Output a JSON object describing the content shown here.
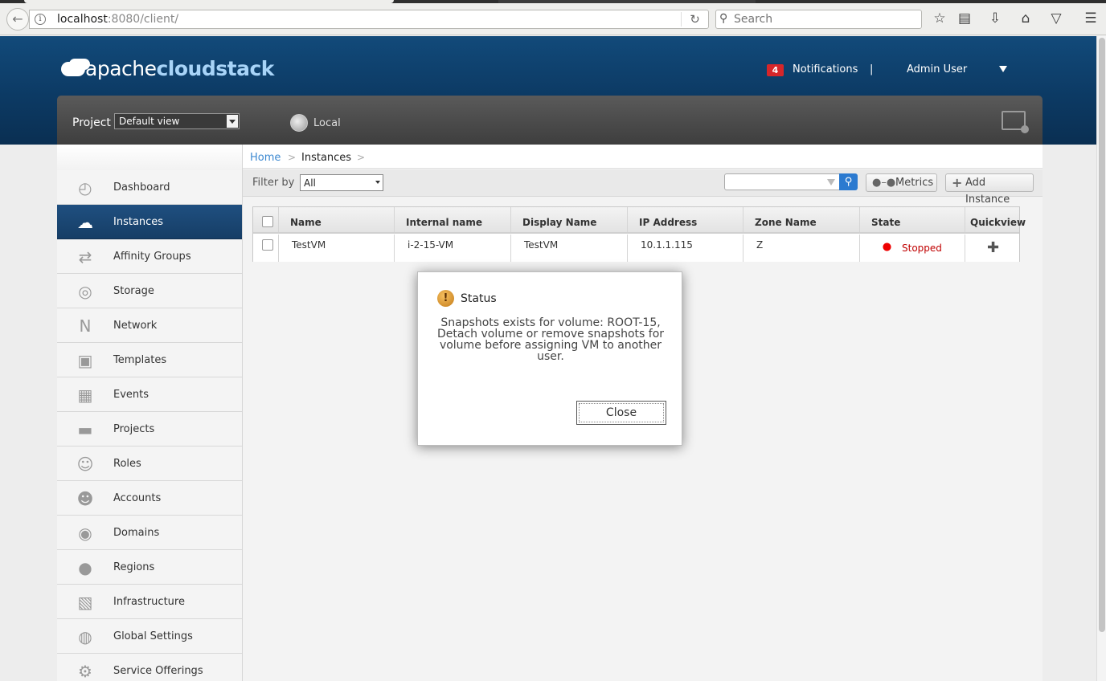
{
  "browser": {
    "url_host": "localhost",
    "url_rest": ":8080/client/",
    "search_placeholder": "Search"
  },
  "header": {
    "logo_prefix": "apache",
    "logo_strong": "cloudstack",
    "notifications_count": "4",
    "notifications_label": "Notifications",
    "separator": "|",
    "user_label": "Admin User"
  },
  "projectbar": {
    "project_label": "Project",
    "project_value": "Default view",
    "zone_label": "Local"
  },
  "sidebar": {
    "items": [
      {
        "label": "Dashboard",
        "icon": "dashboard-icon"
      },
      {
        "label": "Instances",
        "icon": "cloud-icon"
      },
      {
        "label": "Affinity Groups",
        "icon": "affinity-icon"
      },
      {
        "label": "Storage",
        "icon": "storage-icon"
      },
      {
        "label": "Network",
        "icon": "network-icon"
      },
      {
        "label": "Templates",
        "icon": "templates-icon"
      },
      {
        "label": "Events",
        "icon": "calendar-icon"
      },
      {
        "label": "Projects",
        "icon": "folder-icon"
      },
      {
        "label": "Roles",
        "icon": "roles-icon"
      },
      {
        "label": "Accounts",
        "icon": "account-icon"
      },
      {
        "label": "Domains",
        "icon": "domains-icon"
      },
      {
        "label": "Regions",
        "icon": "globe-icon"
      },
      {
        "label": "Infrastructure",
        "icon": "infrastructure-icon"
      },
      {
        "label": "Global Settings",
        "icon": "globe-settings-icon"
      },
      {
        "label": "Service Offerings",
        "icon": "gear-icon"
      }
    ]
  },
  "breadcrumb": {
    "home": "Home",
    "sep": ">",
    "current": "Instances"
  },
  "toolbar": {
    "filter_label": "Filter by",
    "filter_value": "All",
    "metrics_label": "Metrics",
    "add_instance_label": "Add Instance"
  },
  "table": {
    "columns": [
      "Name",
      "Internal name",
      "Display Name",
      "IP Address",
      "Zone Name",
      "State",
      "Quickview"
    ],
    "rows": [
      {
        "name": "TestVM",
        "internal_name": "i-2-15-VM",
        "display_name": "TestVM",
        "ip": "10.1.1.115",
        "zone": "Z",
        "state": "Stopped"
      }
    ]
  },
  "dialog": {
    "title": "Status",
    "message": "Snapshots exists for volume: ROOT-15, Detach volume or remove snapshots for volume before assigning VM to another user.",
    "close_label": "Close"
  },
  "colors": {
    "header_blue": "#0c3a64",
    "active_nav": "#1f4f80",
    "stopped_red": "#c00000",
    "notif_badge": "#d6262a"
  }
}
